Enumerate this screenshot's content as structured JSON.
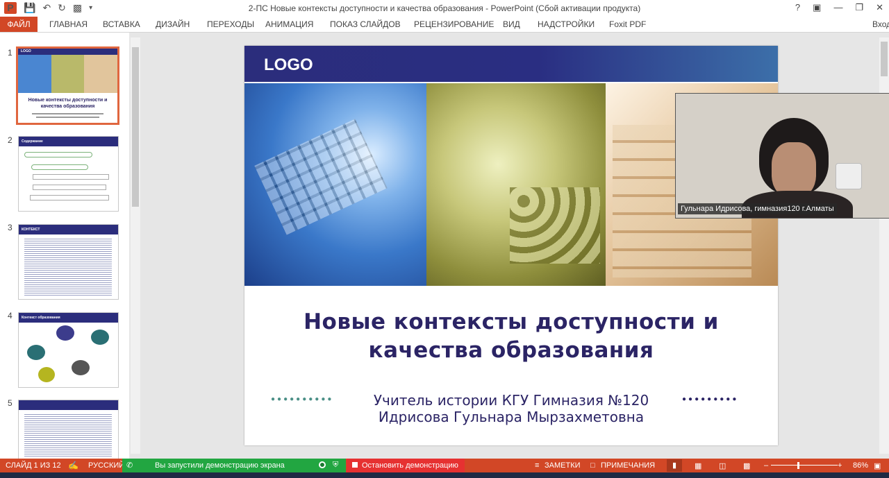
{
  "window": {
    "title": "2-ПС Новые контексты доступности и качества образования - PowerPoint (Сбой активации продукта)",
    "help": "?",
    "signin": "Вход"
  },
  "ribbon": {
    "file": "ФАЙЛ",
    "tabs": [
      "ГЛАВНАЯ",
      "ВСТАВКА",
      "ДИЗАЙН",
      "ПЕРЕХОДЫ",
      "АНИМАЦИЯ",
      "ПОКАЗ СЛАЙДОВ",
      "РЕЦЕНЗИРОВАНИЕ",
      "ВИД",
      "НАДСТРОЙКИ",
      "Foxit PDF"
    ]
  },
  "thumbnails": {
    "nums": [
      "1",
      "2",
      "3",
      "4",
      "5"
    ],
    "t1_logo": "LOGO",
    "t1_title": "Новые контексты доступности и качества образования",
    "t2_title": "Содержание",
    "t3_title": "КОНТЕКСТ",
    "t4_title": "Контекст образования"
  },
  "slide": {
    "logo": "LOGO",
    "title_line1": "Новые контексты доступности и",
    "title_line2": "качества образования",
    "sub_line1": "Учитель истории КГУ Гимназия №120",
    "sub_line2": "Идрисова Гульнара Мырзахметовна",
    "dots_left": "●●●●●●●●●●",
    "dots_right": "●●●●●●●●●"
  },
  "webcam": {
    "label": "Гульнара Идрисова, гимназия120 г.Алматы"
  },
  "statusbar": {
    "slide_counter": "СЛАЙД 1 ИЗ 12",
    "language": "РУССКИЙ",
    "sharing": "Вы запустили демонстрацию экрана",
    "stop_sharing": "Остановить демонстрацию",
    "notes": "ЗАМЕТКИ",
    "comments": "ПРИМЕЧАНИЯ",
    "zoom": "86%"
  },
  "colors": {
    "accent": "#d24726",
    "slide_navy": "#2b2465",
    "share_green": "#22a641",
    "share_red": "#e63131",
    "dots_teal": "#4a8f86"
  }
}
